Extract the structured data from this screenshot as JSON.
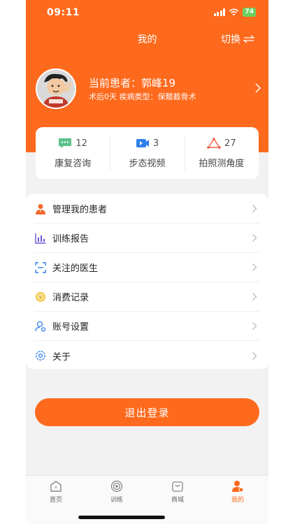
{
  "status_bar": {
    "time": "09:11",
    "battery": "74"
  },
  "header": {
    "title": "我的",
    "switch_label": "切换"
  },
  "profile": {
    "name": "当前患者：郭峰19",
    "sub": "术后0天 疾病类型：保髋截骨术",
    "avatar_icon": "cartoon-avatar-icon"
  },
  "stats": [
    {
      "icon": "chat-bubble-icon",
      "count": "12",
      "label": "康复咨询",
      "color": "#5cc08a"
    },
    {
      "icon": "video-icon",
      "count": "3",
      "label": "步态视频",
      "color": "#2f80ed"
    },
    {
      "icon": "angle-icon",
      "count": "27",
      "label": "拍照测角度",
      "color": "#f05a45"
    }
  ],
  "menu": [
    {
      "icon": "patients-icon",
      "label": "管理我的患者"
    },
    {
      "icon": "bar-chart-icon",
      "label": "训练报告"
    },
    {
      "icon": "scan-doctor-icon",
      "label": "关注的医生"
    },
    {
      "icon": "coin-icon",
      "label": "消费记录"
    },
    {
      "icon": "user-settings-icon",
      "label": "账号设置"
    },
    {
      "icon": "gear-icon",
      "label": "关于"
    }
  ],
  "logout_label": "退出登录",
  "tabs": [
    {
      "icon": "home-icon",
      "label": "首页",
      "active": false
    },
    {
      "icon": "training-icon",
      "label": "训练",
      "active": false
    },
    {
      "icon": "shop-bag-icon",
      "label": "商城",
      "active": false
    },
    {
      "icon": "profile-icon",
      "label": "我的",
      "active": true
    }
  ],
  "colors": {
    "accent": "#fd6a1d",
    "background": "#f2f2f2"
  }
}
